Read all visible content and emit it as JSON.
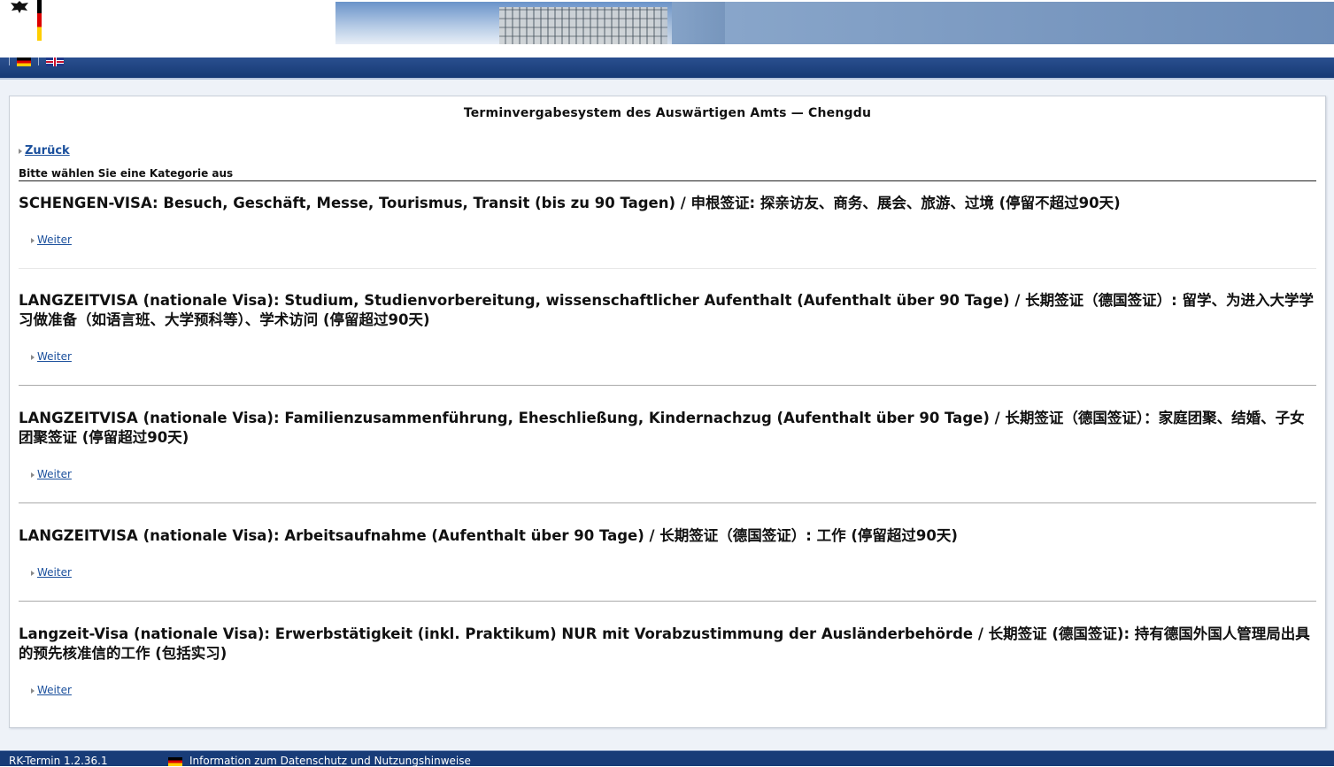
{
  "header": {
    "languages": [
      {
        "icon": "flag-de-icon"
      },
      {
        "icon": "flag-uk-icon"
      }
    ]
  },
  "main": {
    "title": "Terminvergabesystem des Auswärtigen Amts — Chengdu",
    "back_label": "Zurück",
    "subtitle": "Bitte wählen Sie eine Kategorie aus",
    "categories": [
      {
        "title": "SCHENGEN-VISA: Besuch, Geschäft, Messe, Tourismus, Transit (bis zu 90 Tagen) / 申根签证: 探亲访友、商务、展会、旅游、过境 (停留不超过90天)",
        "link": "Weiter"
      },
      {
        "title": "LANGZEITVISA (nationale Visa): Studium, Studienvorbereitung, wissenschaftlicher Aufenthalt (Aufenthalt über 90 Tage) / 长期签证（德国签证）: 留学、为进入大学学习做准备（如语言班、大学预科等）、学术访问 (停留超过90天)",
        "link": "Weiter"
      },
      {
        "title": "LANGZEITVISA (nationale Visa): Familienzusammenführung, Eheschließung, Kindernachzug (Aufenthalt über 90 Tage) / 长期签证（德国签证）：家庭团聚、结婚、子女团聚签证 (停留超过90天)",
        "link": "Weiter"
      },
      {
        "title": "LANGZEITVISA (nationale Visa): Arbeitsaufnahme (Aufenthalt über 90 Tage) / 长期签证（德国签证）: 工作 (停留超过90天)",
        "link": "Weiter"
      },
      {
        "title": "Langzeit-Visa (nationale Visa): Erwerbstätigkeit (inkl. Praktikum) NUR mit Vorabzustimmung der Ausländerbehörde / 长期签证 (德国签证): 持有德国外国人管理局出具的预先核准信的工作 (包括实习)",
        "link": "Weiter"
      }
    ]
  },
  "footer": {
    "version": "RK-Termin 1.2.36.1",
    "privacy_label": "Information zum Datenschutz und Nutzungshinweise"
  }
}
